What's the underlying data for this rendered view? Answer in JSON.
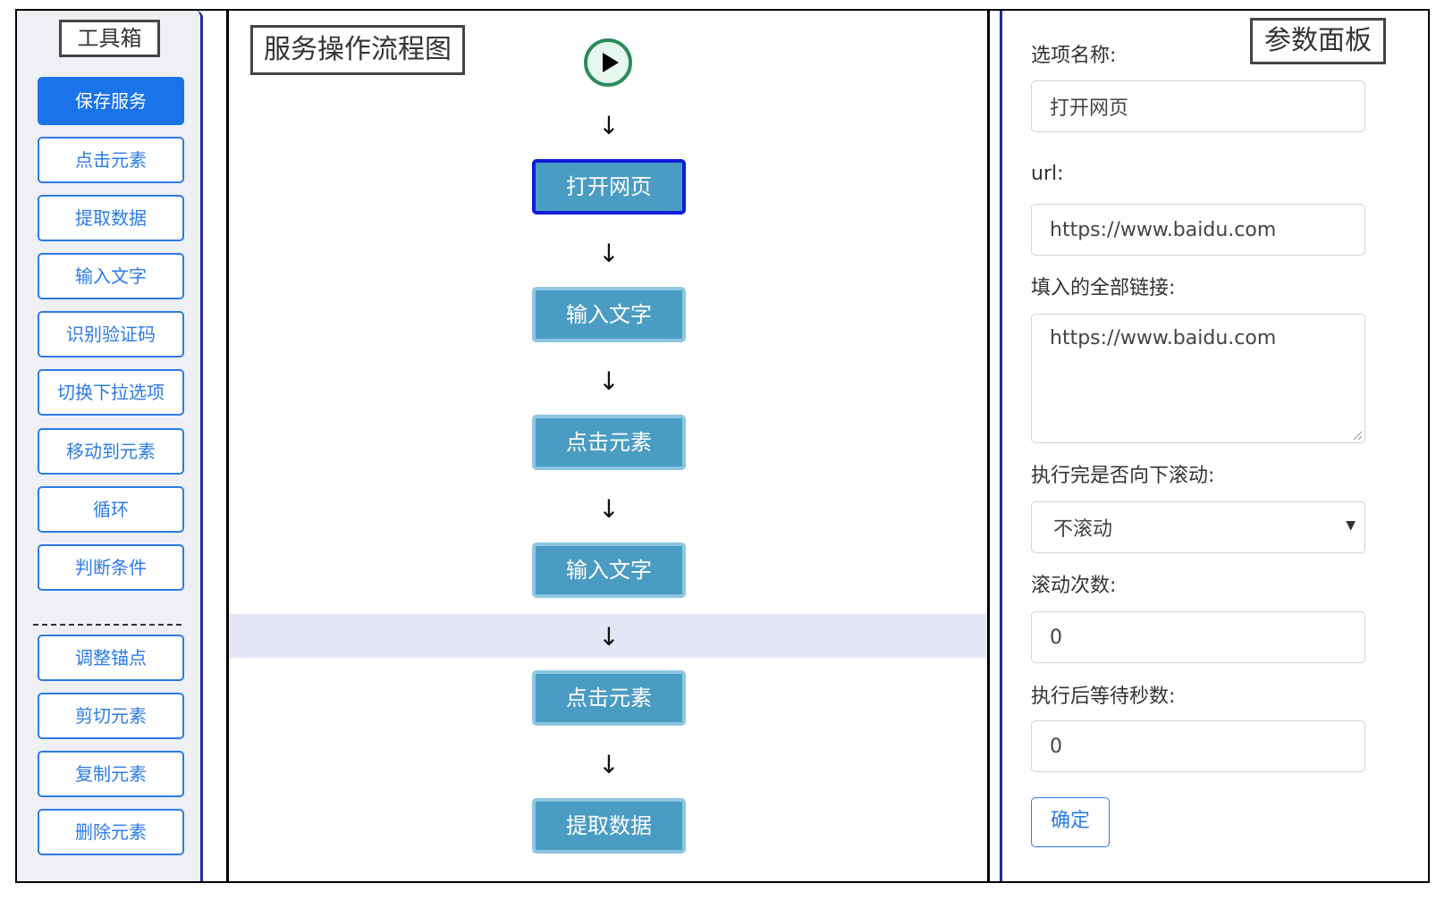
{
  "toolbox": {
    "title": "工具箱",
    "save_label": "保存服务",
    "items": [
      "点击元素",
      "提取数据",
      "输入文字",
      "识别验证码",
      "切换下拉选项",
      "移动到元素",
      "循环",
      "判断条件"
    ],
    "separator": "-----------------",
    "edit_items": [
      "调整锚点",
      "剪切元素",
      "复制元素",
      "删除元素"
    ]
  },
  "flow": {
    "title": "服务操作流程图",
    "arrow": "↓",
    "nodes": [
      "打开网页",
      "输入文字",
      "点击元素",
      "输入文字",
      "点击元素",
      "提取数据"
    ]
  },
  "params": {
    "title": "参数面板",
    "option_name_label": "选项名称:",
    "option_name_value": "打开网页",
    "url_label": "url:",
    "url_value": "https://www.baidu.com",
    "all_links_label": "填入的全部链接:",
    "all_links_value": "https://www.baidu.com",
    "scroll_label": "执行完是否向下滚动:",
    "scroll_value": "不滚动",
    "scroll_count_label": "滚动次数:",
    "scroll_count_value": "0",
    "wait_label": "执行后等待秒数:",
    "wait_value": "0",
    "confirm_label": "确定"
  },
  "colors": {
    "primary": "#1a73e8",
    "node_fill": "#4b9cc3",
    "node_border": "#8cc6e2",
    "active_border": "#0d1fd9",
    "highlight": "#e4e6f5",
    "play_ring": "#2a8c59"
  }
}
